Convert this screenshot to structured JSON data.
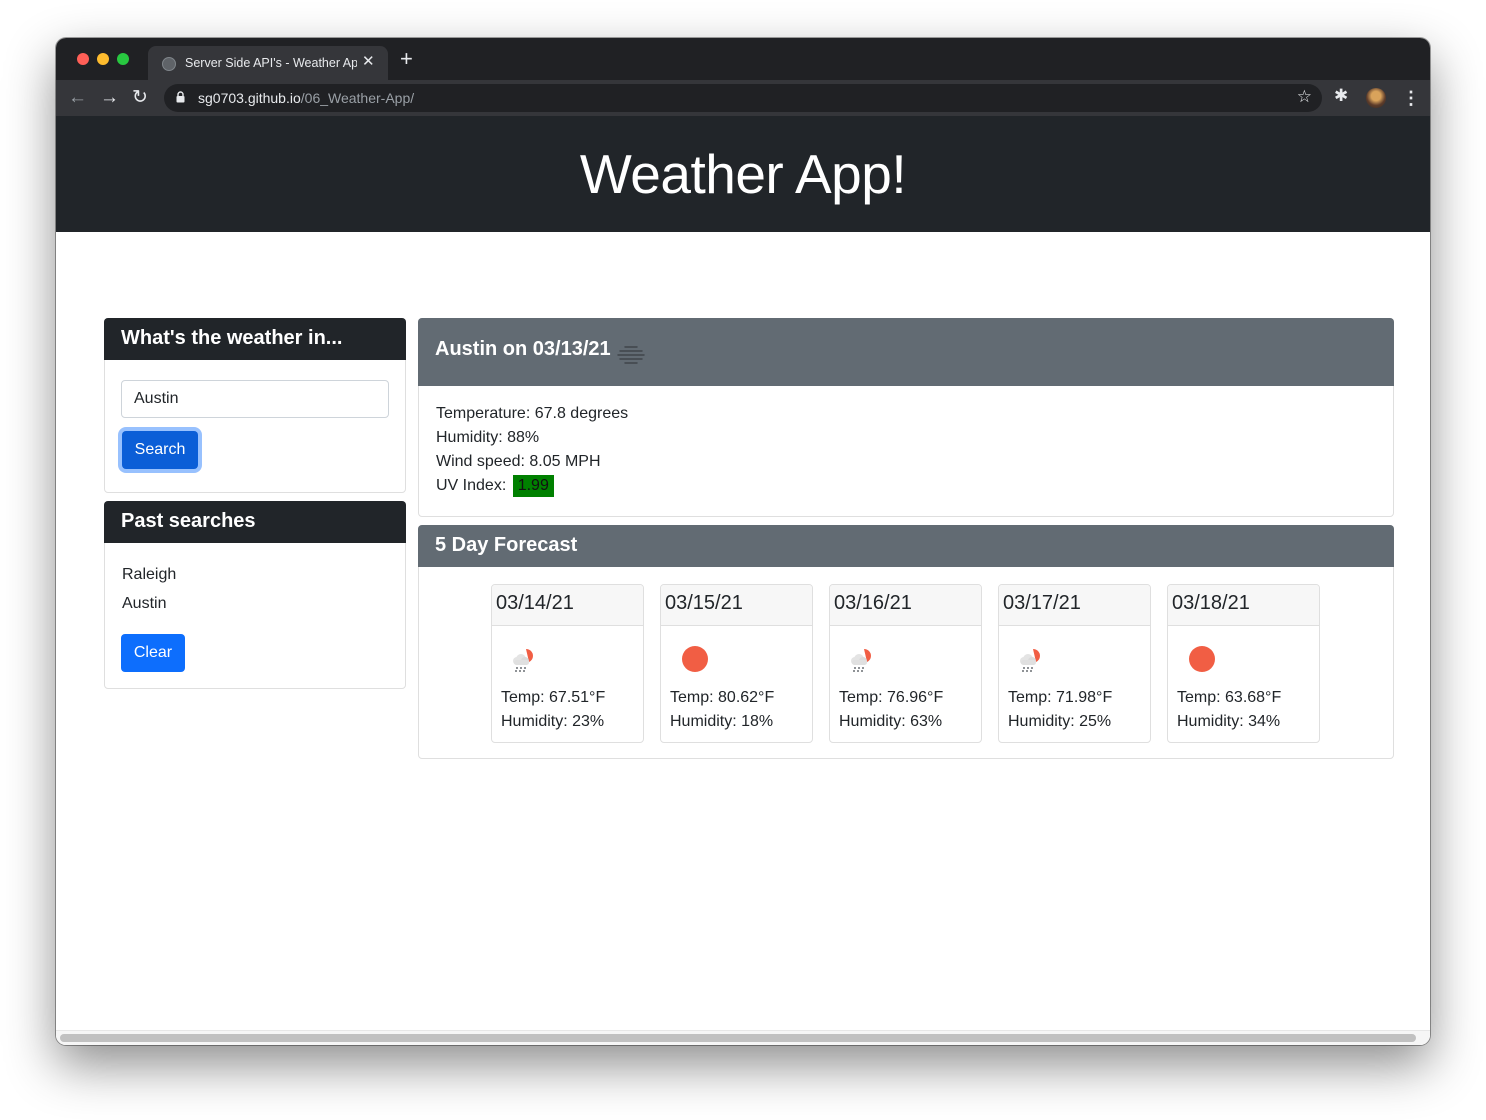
{
  "browser": {
    "tab_title": "Server Side API's - Weather App",
    "url_domain": "sg0703.github.io",
    "url_path": "/06_Weather-App/",
    "close_glyph": "✕",
    "new_tab_glyph": "+",
    "back_glyph": "←",
    "forward_glyph": "→",
    "reload_glyph": "↻",
    "star_glyph": "☆",
    "extensions_glyph": "✱",
    "menu_glyph": "⋮"
  },
  "app": {
    "title": "Weather App!"
  },
  "search": {
    "heading": "What's the weather in...",
    "input_value": "Austin",
    "button_label": "Search"
  },
  "past": {
    "heading": "Past searches",
    "items": [
      "Raleigh",
      "Austin"
    ],
    "clear_label": "Clear"
  },
  "current": {
    "heading": "Austin on 03/13/21",
    "icon": "haze-icon",
    "temperature": "Temperature: 67.8 degrees",
    "humidity": "Humidity: 88%",
    "wind": "Wind speed: 8.05 MPH",
    "uv_label": "UV Index: ",
    "uv_value": "1.99",
    "uv_color": "#008000"
  },
  "forecast": {
    "heading": "5 Day Forecast",
    "days": [
      {
        "date": "03/14/21",
        "icon": "rain-sun-icon",
        "temp": "Temp: 67.51°F",
        "humidity": "Humidity: 23%"
      },
      {
        "date": "03/15/21",
        "icon": "sun-icon",
        "temp": "Temp: 80.62°F",
        "humidity": "Humidity: 18%"
      },
      {
        "date": "03/16/21",
        "icon": "rain-sun-icon",
        "temp": "Temp: 76.96°F",
        "humidity": "Humidity: 63%"
      },
      {
        "date": "03/17/21",
        "icon": "rain-sun-icon",
        "temp": "Temp: 71.98°F",
        "humidity": "Humidity: 25%"
      },
      {
        "date": "03/18/21",
        "icon": "sun-icon",
        "temp": "Temp: 63.68°F",
        "humidity": "Humidity: 34%"
      }
    ]
  },
  "colors": {
    "header_dark": "#212529",
    "card_gray": "#626b73",
    "button_primary": "#0d6efd",
    "sun": "#f15e44"
  }
}
